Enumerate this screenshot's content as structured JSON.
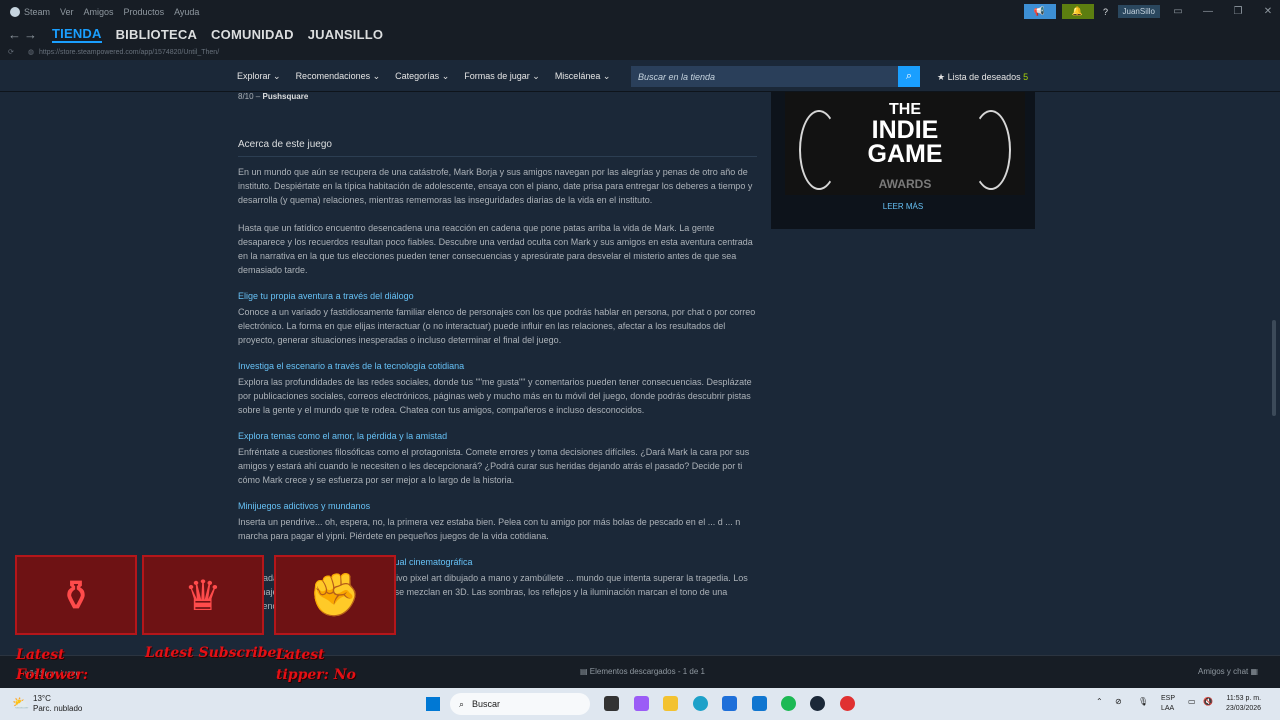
{
  "menubar": {
    "app": "Steam",
    "items": [
      "Ver",
      "Amigos",
      "Productos",
      "Ayuda"
    ],
    "user": "JuanSillo"
  },
  "nav": {
    "tabs": [
      "TIENDA",
      "BIBLIOTECA",
      "COMUNIDAD",
      "JUANSILLO"
    ],
    "url": "https://store.steampowered.com/app/1574820/Until_Then/"
  },
  "store_nav": {
    "items": [
      "Explorar",
      "Recomendaciones",
      "Categorías",
      "Formas de jugar",
      "Miscelánea"
    ],
    "search_placeholder": "Buscar en la tienda",
    "wishlist_label": "Lista de deseados",
    "wishlist_count": "5"
  },
  "content": {
    "review_score": "8/10 –",
    "review_source": "Pushsquare",
    "about_heading": "Acerca de este juego",
    "para1": "En un mundo que aún se recupera de una catástrofe, Mark Borja y sus amigos navegan por las alegrías y penas de otro año de instituto. Despiértate en la típica habitación de adolescente, ensaya con el piano, date prisa para entregar los deberes a tiempo y desarrolla (y quema) relaciones, mientras rememoras las inseguridades diarias de la vida en el instituto.",
    "para2": "Hasta que un fatídico encuentro desencadena una reacción en cadena que pone patas arriba la vida de Mark. La gente desaparece y los recuerdos resultan poco fiables. Descubre una verdad oculta con Mark y sus amigos en esta aventura centrada en la narrativa en la que tus elecciones pueden tener consecuencias y apresúrate para desvelar el misterio antes de que sea demasiado tarde.",
    "h1": "Elige tu propia aventura a través del diálogo",
    "p1": "Conoce a un variado y fastidiosamente familiar elenco de personajes con los que podrás hablar en persona, por chat o por correo electrónico. La forma en que elijas interactuar (o no interactuar) puede influir en las relaciones, afectar a los resultados del proyecto, generar situaciones inesperadas o incluso determinar el final del juego.",
    "h2": "Investiga el escenario a través de la tecnología cotidiana",
    "p2": "Explora las profundidades de las redes sociales, donde tus \"\"me gusta\"\" y comentarios pueden tener consecuencias. Desplázate por publicaciones sociales, correos electrónicos, páginas web y mucho más en tu móvil del juego, donde podrás descubrir pistas sobre la gente y el mundo que te rodea. Chatea con tus amigos, compañeros e incluso desconocidos.",
    "h3": "Explora temas como el amor, la pérdida y la amistad",
    "p3": "Enfréntate a cuestiones filosóficas como el protagonista. Comete errores y toma decisiones difíciles. ¿Dará Mark la cara por sus amigos y estará ahí cuando le necesiten o les decepcionará? ¿Podrá curar sus heridas dejando atrás el pasado? Decide por ti cómo Mark crece y se esfuerza por ser mejor a lo largo de la historia.",
    "h4": "Minijuegos adictivos y mundanos",
    "p4": "Inserta un pendrive... oh, espera, no, la primera vez estaba bien. Pelea con tu amigo por más bolas de pescado en el ... d ... n marcha para pagar el yipni. Piérdete en pequeños juegos de la vida cotidiana.",
    "h5": "sual cinematográfica",
    "p5": "resentada de forma única con un llamativo pixel art dibujado a mano y zambúllete ... mundo que intenta superar la tragedia. Los personajes, los paisajes y el escenario se mezclan en 3D. Las sombras, los reflejos y la iluminación marcan el tono de una experiencia creada con mucho"
  },
  "sidebar": {
    "award_line1": "THE",
    "award_line2": "INDIE",
    "award_line3": "GAME",
    "award_line4": "AWARDS",
    "read_more": "LEER MÁS"
  },
  "bottom": {
    "add_game": "Añadir un juego",
    "downloads": "Elementos descargados - 1 de 1",
    "chat": "Amigos y chat"
  },
  "overlay": {
    "follower": "Latest Follower: extremo_hulk",
    "subscriber": "Latest Subscriber:",
    "tipper": "Latest tipper: No data"
  },
  "taskbar": {
    "temp": "13°C",
    "weather": "Parc. nublado",
    "search": "Buscar",
    "lang1": "ESP",
    "lang2": "LAA",
    "time": "11:53 p. m.",
    "date": "23/03/2026"
  },
  "colors": {
    "accent": "#1a9fff",
    "link": "#66c0f4",
    "background": "#1b2838"
  }
}
